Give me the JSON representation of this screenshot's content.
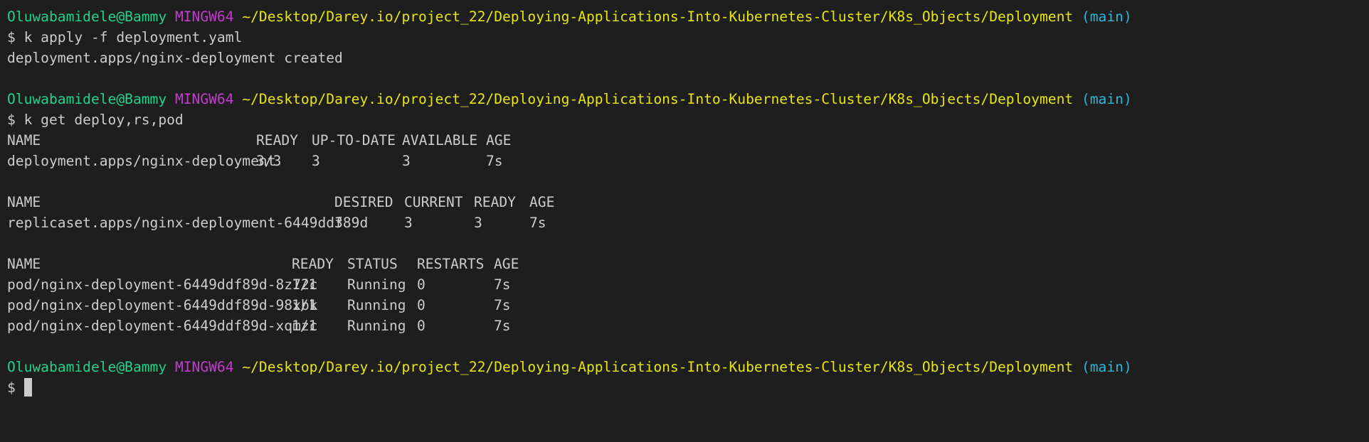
{
  "prompt": {
    "user": "Oluwabamidele@Bammy",
    "shell": "MINGW64",
    "path": "~/Desktop/Darey.io/project_22/Deploying-Applications-Into-Kubernetes-Cluster/K8s_Objects/Deployment",
    "branch": "(main)",
    "symbol": "$"
  },
  "commands": [
    {
      "command": "k apply -f deployment.yaml",
      "output": [
        "deployment.apps/nginx-deployment created"
      ]
    },
    {
      "command": "k get deploy,rs,pod"
    }
  ],
  "deployments_table": {
    "headers": [
      "NAME",
      "READY",
      "UP-TO-DATE",
      "AVAILABLE",
      "AGE"
    ],
    "rows": [
      [
        "deployment.apps/nginx-deployment",
        "3/3",
        "3",
        "3",
        "7s"
      ]
    ]
  },
  "replicasets_table": {
    "headers": [
      "NAME",
      "DESIRED",
      "CURRENT",
      "READY",
      "AGE"
    ],
    "rows": [
      [
        "replicaset.apps/nginx-deployment-6449ddf89d",
        "3",
        "3",
        "3",
        "7s"
      ]
    ]
  },
  "pods_table": {
    "headers": [
      "NAME",
      "READY",
      "STATUS",
      "RESTARTS",
      "AGE"
    ],
    "rows": [
      [
        "pod/nginx-deployment-6449ddf89d-8z72c",
        "1/1",
        "Running",
        "0",
        "7s"
      ],
      [
        "pod/nginx-deployment-6449ddf89d-98xbk",
        "1/1",
        "Running",
        "0",
        "7s"
      ],
      [
        "pod/nginx-deployment-6449ddf89d-xqmzc",
        "1/1",
        "Running",
        "0",
        "7s"
      ]
    ]
  },
  "colors": {
    "background": "#1e1e1e",
    "user": "#23d18b",
    "shell": "#c33ccf",
    "path": "#e5e510",
    "branch": "#29b8db",
    "text": "#cccccc"
  }
}
